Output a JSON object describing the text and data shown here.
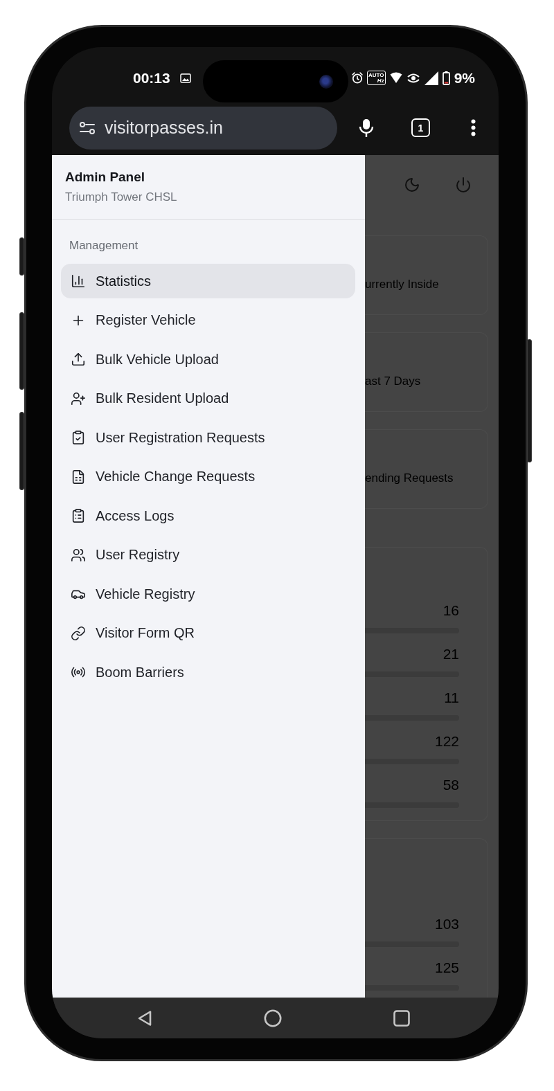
{
  "status_bar": {
    "time": "00:13",
    "refresh_badge": {
      "top": "AUTO",
      "bottom": "Hz"
    },
    "battery": "9%"
  },
  "browser_toolbar": {
    "url": "visitorpasses.in",
    "tab_count": "1"
  },
  "drawer": {
    "title": "Admin Panel",
    "subtitle": "Triumph Tower CHSL",
    "section_label": "Management",
    "items": [
      {
        "label": "Statistics",
        "selected": true
      },
      {
        "label": "Register Vehicle",
        "selected": false
      },
      {
        "label": "Bulk Vehicle Upload",
        "selected": false
      },
      {
        "label": "Bulk Resident Upload",
        "selected": false
      },
      {
        "label": "User Registration Requests",
        "selected": false
      },
      {
        "label": "Vehicle Change Requests",
        "selected": false
      },
      {
        "label": "Access Logs",
        "selected": false
      },
      {
        "label": "User Registry",
        "selected": false
      },
      {
        "label": "Vehicle Registry",
        "selected": false
      },
      {
        "label": "Visitor Form QR",
        "selected": false
      },
      {
        "label": "Boom Barriers",
        "selected": false
      }
    ]
  },
  "background_page": {
    "stat_cards": [
      {
        "label": "urrently Inside"
      },
      {
        "label": "ast 7 Days"
      },
      {
        "label": "ending Requests"
      }
    ],
    "list_cards": [
      {
        "rows": [
          {
            "count": "16"
          },
          {
            "count": "21"
          },
          {
            "count": "11"
          },
          {
            "count": "122"
          },
          {
            "count": "58"
          }
        ]
      },
      {
        "rows": [
          {
            "count": "103"
          },
          {
            "count": "125"
          }
        ]
      }
    ]
  }
}
